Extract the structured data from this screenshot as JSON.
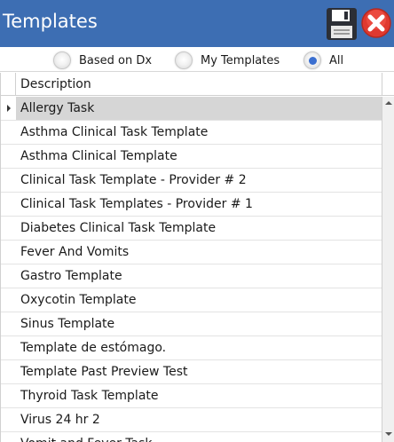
{
  "window": {
    "title": "Templates",
    "accent": "#3d6eb3",
    "save_icon": "save-icon",
    "close_icon": "close-icon"
  },
  "filter": {
    "options": [
      {
        "label": "Based on Dx",
        "checked": false
      },
      {
        "label": "My Templates",
        "checked": false
      },
      {
        "label": "All",
        "checked": true
      }
    ]
  },
  "grid": {
    "columns": [
      "Description"
    ],
    "selected_index": 0,
    "rows": [
      "Allergy Task",
      "Asthma Clinical Task Template",
      "Asthma Clinical Template",
      "Clinical Task Template - Provider # 2",
      "Clinical Task Templates - Provider # 1",
      "Diabetes Clinical Task Template",
      "Fever And Vomits",
      "Gastro Template",
      "Oxycotin Template",
      "Sinus Template",
      "Template de estómago.",
      "Template Past Preview Test",
      "Thyroid Task Template",
      "Virus 24 hr 2",
      "Vomit and Fever Task"
    ]
  }
}
